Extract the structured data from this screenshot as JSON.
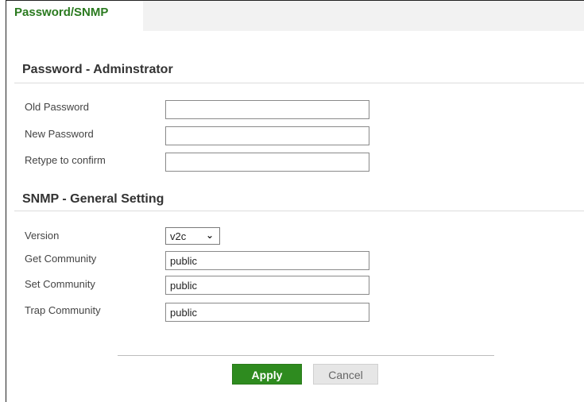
{
  "tab": {
    "label": "Password/SNMP"
  },
  "password_section": {
    "title": "Password - Adminstrator",
    "old_password_label": "Old Password",
    "new_password_label": "New Password",
    "retype_label": "Retype to confirm",
    "old_password_value": "",
    "new_password_value": "",
    "retype_value": ""
  },
  "snmp_section": {
    "title": "SNMP - General Setting",
    "version_label": "Version",
    "version_value": "v2c",
    "get_community_label": "Get Community",
    "get_community_value": "public",
    "set_community_label": "Set Community",
    "set_community_value": "public",
    "trap_community_label": "Trap Community",
    "trap_community_value": "public"
  },
  "actions": {
    "apply_label": "Apply",
    "cancel_label": "Cancel"
  },
  "icons": {
    "version_dropdown": "chevron-down-icon"
  },
  "colors": {
    "accent": "#2e8b1f",
    "tab_text": "#2a7a1f"
  }
}
